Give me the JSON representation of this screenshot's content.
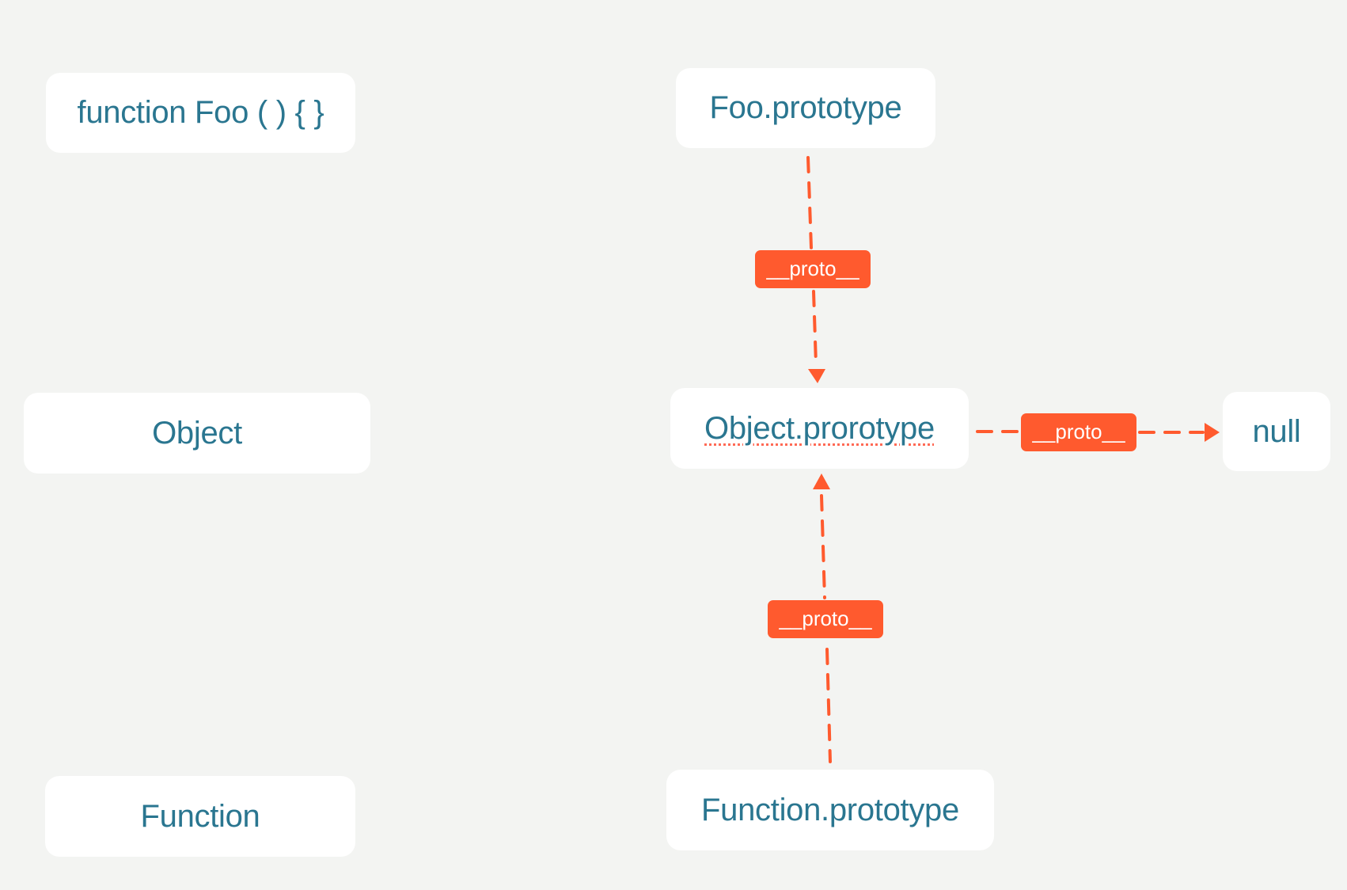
{
  "diagram": {
    "title": "",
    "colors": {
      "background": "#f3f4f2",
      "node_fill": "#ffffff",
      "node_text": "#2a7690",
      "edge": "#ff5a2e",
      "badge_fill": "#ff5a2e",
      "badge_text": "#ffffff"
    },
    "nodes": {
      "foo_function": {
        "label": "function Foo ( ) { }"
      },
      "foo_prototype": {
        "label": "Foo.prototype"
      },
      "object": {
        "label": "Object"
      },
      "object_prototype": {
        "label": "Object.prorotype",
        "spellcheck_underline": true
      },
      "null": {
        "label": "null"
      },
      "function": {
        "label": "Function"
      },
      "function_prototype": {
        "label": "Function.prototype"
      }
    },
    "edges": [
      {
        "from": "foo_prototype",
        "to": "object_prototype",
        "label": "__proto__",
        "style": "dashed",
        "arrow": "end"
      },
      {
        "from": "object_prototype",
        "to": "null",
        "label": "__proto__",
        "style": "dashed",
        "arrow": "end"
      },
      {
        "from": "function_prototype",
        "to": "object_prototype",
        "label": "__proto__",
        "style": "dashed",
        "arrow": "end"
      }
    ]
  }
}
